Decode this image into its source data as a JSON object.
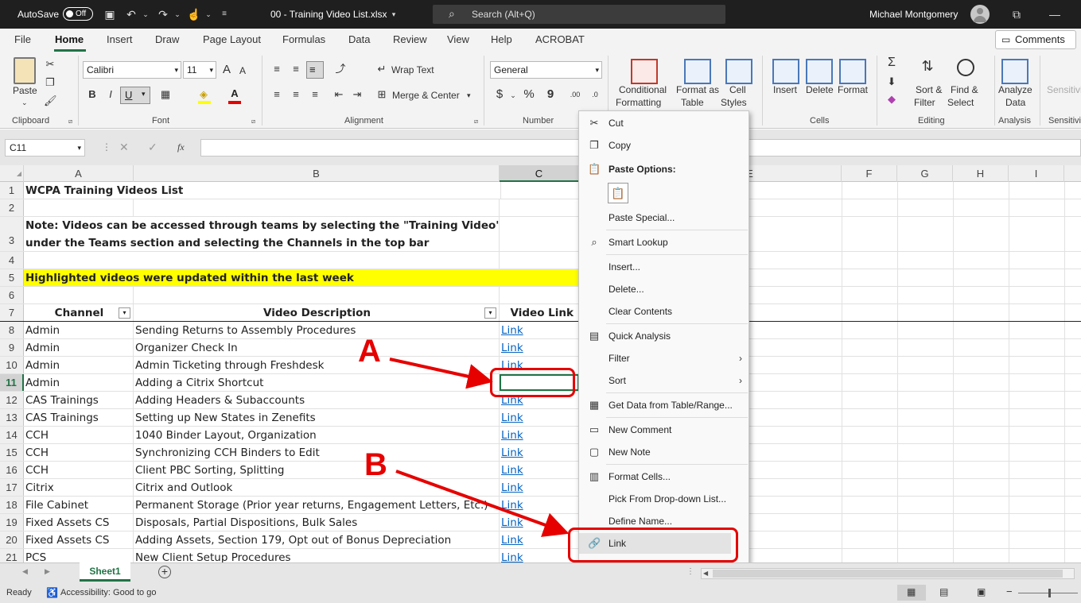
{
  "titlebar": {
    "autosave_label": "AutoSave",
    "autosave_state": "Off",
    "filename": "00 - Training Video List.xlsx",
    "search_placeholder": "Search (Alt+Q)",
    "user_name": "Michael Montgomery"
  },
  "menu": {
    "tabs": [
      "File",
      "Home",
      "Insert",
      "Draw",
      "Page Layout",
      "Formulas",
      "Data",
      "Review",
      "View",
      "Help",
      "ACROBAT"
    ],
    "active_tab": "Home",
    "comments_button": "Comments"
  },
  "ribbon": {
    "paste_label": "Paste",
    "font_name": "Calibri",
    "font_size": "11",
    "bold": "B",
    "italic": "I",
    "underline": "U",
    "wrap_text": "Wrap Text",
    "merge_center": "Merge & Center",
    "number_format": "General",
    "conditional_formatting": [
      "Conditional",
      "Formatting"
    ],
    "format_as_table": [
      "Format as",
      "Table"
    ],
    "cell_styles": [
      "Cell",
      "Styles"
    ],
    "insert": "Insert",
    "delete": "Delete",
    "format": "Format",
    "sort_filter": [
      "Sort &",
      "Filter"
    ],
    "find_select": [
      "Find &",
      "Select"
    ],
    "analyze_data": [
      "Analyze",
      "Data"
    ],
    "sensitivity": "Sensitivi",
    "groups": {
      "clipboard": "Clipboard",
      "font": "Font",
      "alignment": "Alignment",
      "number": "Number",
      "cells": "Cells",
      "editing": "Editing",
      "analysis": "Analysis",
      "sensitivity": "Sensitivi"
    }
  },
  "formula_bar": {
    "name_box": "C11",
    "fx": "fx",
    "value": ""
  },
  "columns": [
    "A",
    "B",
    "C",
    "D",
    "E",
    "F",
    "G",
    "H",
    "I"
  ],
  "rows": [
    {
      "n": "1",
      "a": "WCPA Training Videos List",
      "b": "",
      "c": ""
    },
    {
      "n": "2",
      "a": "",
      "b": "",
      "c": ""
    },
    {
      "n": "3",
      "a": "Note: Videos can be accessed through teams by selecting the \"Training Video\" group",
      "a2": "under the Teams section and selecting the Channels in the top bar",
      "b": "",
      "c": ""
    },
    {
      "n": "4",
      "a": "",
      "b": "",
      "c": ""
    },
    {
      "n": "5",
      "a": "Highlighted videos were updated within the last week",
      "b": "",
      "c": ""
    },
    {
      "n": "6",
      "a": "",
      "b": "",
      "c": ""
    },
    {
      "n": "7",
      "a": "Channel",
      "b": "Video Description",
      "c": "Video Link"
    },
    {
      "n": "8",
      "a": "Admin",
      "b": "Sending Returns to Assembly Procedures",
      "c": "Link"
    },
    {
      "n": "9",
      "a": "Admin",
      "b": "Organizer Check In",
      "c": "Link"
    },
    {
      "n": "10",
      "a": "Admin",
      "b": "Admin Ticketing through Freshdesk",
      "c": "Link"
    },
    {
      "n": "11",
      "a": "Admin",
      "b": "Adding a Citrix Shortcut",
      "c": ""
    },
    {
      "n": "12",
      "a": "CAS Trainings",
      "b": "Adding Headers & Subaccounts",
      "c": "Link"
    },
    {
      "n": "13",
      "a": "CAS Trainings",
      "b": "Setting up New States in Zenefits",
      "c": "Link"
    },
    {
      "n": "14",
      "a": "CCH",
      "b": "1040 Binder Layout, Organization",
      "c": "Link"
    },
    {
      "n": "15",
      "a": "CCH",
      "b": "Synchronizing CCH Binders to Edit",
      "c": "Link"
    },
    {
      "n": "16",
      "a": "CCH",
      "b": "Client PBC Sorting, Splitting",
      "c": "Link"
    },
    {
      "n": "17",
      "a": "Citrix",
      "b": "Citrix and Outlook",
      "c": "Link"
    },
    {
      "n": "18",
      "a": "File Cabinet",
      "b": "Permanent Storage (Prior year returns, Engagement Letters, Etc.)",
      "c": "Link"
    },
    {
      "n": "19",
      "a": "Fixed Assets CS",
      "b": "Disposals, Partial Dispositions, Bulk Sales",
      "c": "Link"
    },
    {
      "n": "20",
      "a": "Fixed Assets CS",
      "b": "Adding Assets, Section 179, Opt out of Bonus Depreciation",
      "c": "Link"
    },
    {
      "n": "21",
      "a": "PCS",
      "b": "New Client Setup Procedures",
      "c": "Link"
    }
  ],
  "context_menu": {
    "cut": "Cut",
    "copy": "Copy",
    "paste_options": "Paste Options:",
    "paste_special": "Paste Special...",
    "smart_lookup": "Smart Lookup",
    "insert": "Insert...",
    "delete": "Delete...",
    "clear_contents": "Clear Contents",
    "quick_analysis": "Quick Analysis",
    "filter": "Filter",
    "sort": "Sort",
    "get_data": "Get Data from Table/Range...",
    "new_comment": "New Comment",
    "new_note": "New Note",
    "format_cells": "Format Cells...",
    "pick_dropdown": "Pick From Drop-down List...",
    "define_name": "Define Name...",
    "link": "Link"
  },
  "annotations": {
    "a": "A",
    "b": "B"
  },
  "sheet_tab": "Sheet1",
  "status": {
    "ready": "Ready",
    "accessibility": "Accessibility: Good to go"
  },
  "colors": {
    "highlight_yellow": "#ffff00",
    "link_blue": "#0563c1",
    "annotation_red": "#e60000",
    "excel_green": "#217346"
  }
}
